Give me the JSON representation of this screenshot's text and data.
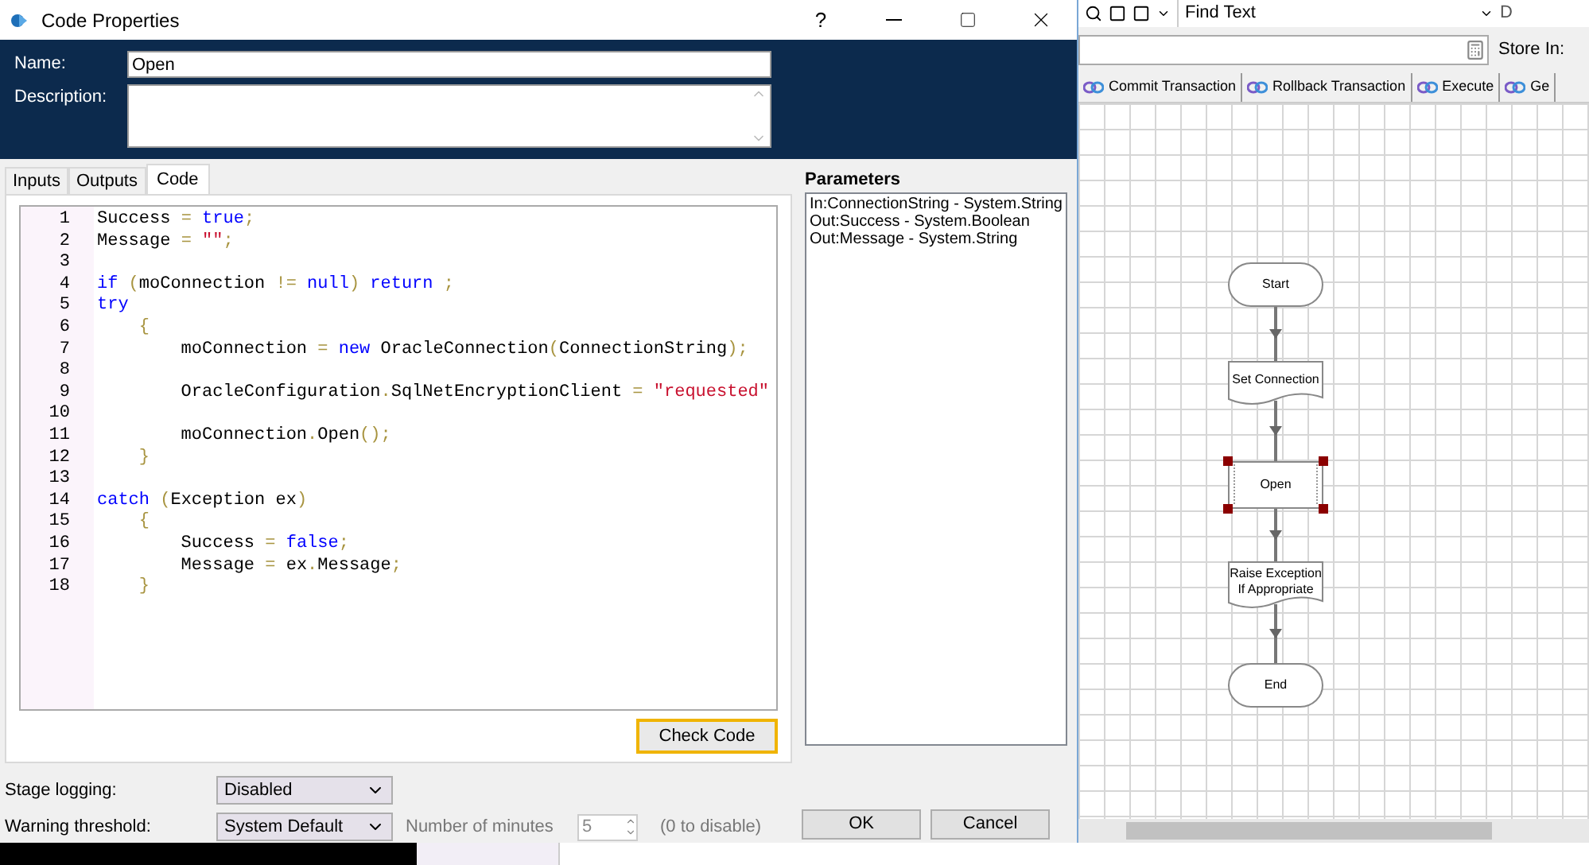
{
  "dialog": {
    "title": "Code Properties",
    "help": "?",
    "name_label": "Name:",
    "name_value": "Open",
    "description_label": "Description:",
    "tabs": [
      {
        "label": "Inputs",
        "selected": false
      },
      {
        "label": "Outputs",
        "selected": false
      },
      {
        "label": "Code",
        "selected": true
      }
    ],
    "code_lines": [
      {
        "number": "1",
        "tokens": [
          {
            "text": "Success",
            "kind": "plain"
          },
          {
            "text": " = ",
            "kind": "punct"
          },
          {
            "text": "true",
            "kind": "keyword"
          },
          {
            "text": ";",
            "kind": "punct"
          }
        ]
      },
      {
        "number": "2",
        "tokens": [
          {
            "text": "Message",
            "kind": "plain"
          },
          {
            "text": " = ",
            "kind": "punct"
          },
          {
            "text": "\"\"",
            "kind": "string"
          },
          {
            "text": ";",
            "kind": "punct"
          }
        ]
      },
      {
        "number": "3"
      },
      {
        "number": "4",
        "tokens": [
          {
            "text": "if",
            "kind": "keyword"
          },
          {
            "text": " (",
            "kind": "punct"
          },
          {
            "text": "moConnection",
            "kind": "plain"
          },
          {
            "text": " != ",
            "kind": "punct"
          },
          {
            "text": "null",
            "kind": "keyword"
          },
          {
            "text": ") ",
            "kind": "punct"
          },
          {
            "text": "return",
            "kind": "keyword"
          },
          {
            "text": " ;",
            "kind": "punct"
          }
        ]
      },
      {
        "number": "5",
        "tokens": [
          {
            "text": "try",
            "kind": "keyword"
          }
        ]
      },
      {
        "number": "6",
        "tokens": [
          {
            "text": "    {",
            "kind": "punct"
          }
        ]
      },
      {
        "number": "7",
        "tokens": [
          {
            "text": "        moConnection",
            "kind": "plain"
          },
          {
            "text": " = ",
            "kind": "punct"
          },
          {
            "text": "new",
            "kind": "keyword"
          },
          {
            "text": " OracleConnection",
            "kind": "plain"
          },
          {
            "text": "(",
            "kind": "punct"
          },
          {
            "text": "ConnectionString",
            "kind": "plain"
          },
          {
            "text": ");",
            "kind": "punct"
          }
        ]
      },
      {
        "number": "8"
      },
      {
        "number": "9",
        "tokens": [
          {
            "text": "        OracleConfiguration",
            "kind": "plain"
          },
          {
            "text": ".",
            "kind": "punct"
          },
          {
            "text": "SqlNetEncryptionClient",
            "kind": "plain"
          },
          {
            "text": " = ",
            "kind": "punct"
          },
          {
            "text": "\"requested\"",
            "kind": "string"
          }
        ]
      },
      {
        "number": "10"
      },
      {
        "number": "11",
        "tokens": [
          {
            "text": "        moConnection",
            "kind": "plain"
          },
          {
            "text": ".",
            "kind": "punct"
          },
          {
            "text": "Open",
            "kind": "plain"
          },
          {
            "text": "();",
            "kind": "punct"
          }
        ]
      },
      {
        "number": "12",
        "tokens": [
          {
            "text": "    }",
            "kind": "punct"
          }
        ]
      },
      {
        "number": "13"
      },
      {
        "number": "14",
        "tokens": [
          {
            "text": "catch",
            "kind": "keyword"
          },
          {
            "text": " (",
            "kind": "punct"
          },
          {
            "text": "Exception ex",
            "kind": "plain"
          },
          {
            "text": ")",
            "kind": "punct"
          }
        ]
      },
      {
        "number": "15",
        "tokens": [
          {
            "text": "    {",
            "kind": "punct"
          }
        ]
      },
      {
        "number": "16",
        "tokens": [
          {
            "text": "        Success",
            "kind": "plain"
          },
          {
            "text": " = ",
            "kind": "punct"
          },
          {
            "text": "false",
            "kind": "keyword"
          },
          {
            "text": ";",
            "kind": "punct"
          }
        ]
      },
      {
        "number": "17",
        "tokens": [
          {
            "text": "        Message",
            "kind": "plain"
          },
          {
            "text": " = ",
            "kind": "punct"
          },
          {
            "text": "ex",
            "kind": "plain"
          },
          {
            "text": ".",
            "kind": "punct"
          },
          {
            "text": "Message",
            "kind": "plain"
          },
          {
            "text": ";",
            "kind": "punct"
          }
        ]
      },
      {
        "number": "18",
        "tokens": [
          {
            "text": "    }",
            "kind": "punct"
          }
        ]
      }
    ],
    "check_code_button": "Check Code",
    "parameters_title": "Parameters",
    "parameters": [
      "In:ConnectionString - System.String",
      "Out:Success - System.Boolean",
      "Out:Message - System.String"
    ],
    "stage_logging": {
      "label": "Stage logging:",
      "value": "Disabled"
    },
    "warning_threshold": {
      "label": "Warning threshold:",
      "value": "System Default"
    },
    "minutes": {
      "label": "Number of minutes",
      "value": "5",
      "hint": "(0 to disable)"
    },
    "buttons": [
      "OK",
      "Cancel"
    ]
  },
  "toolbar": {
    "find_text": "Find Text",
    "cut_label": "D",
    "store_in_label": "Store In:"
  },
  "action_tabs": [
    "Commit Transaction",
    "Rollback Transaction",
    "Execute",
    "Ge"
  ],
  "flowchart": {
    "nodes": [
      {
        "kind": "terminal",
        "label": "Start",
        "selected": false
      },
      {
        "kind": "process",
        "label": "Set Connection",
        "selected": false
      },
      {
        "kind": "code",
        "label": "Open",
        "selected": true
      },
      {
        "kind": "process",
        "label": "Raise Exception If Appropriate",
        "selected": false
      },
      {
        "kind": "terminal",
        "label": "End",
        "selected": false
      }
    ]
  }
}
